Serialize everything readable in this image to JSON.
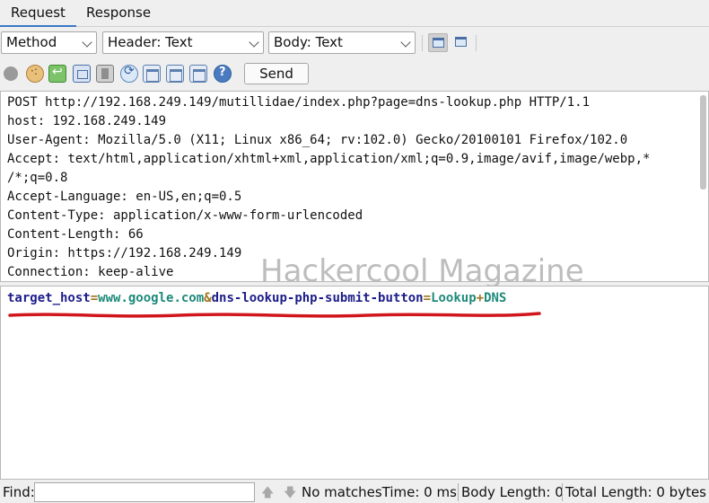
{
  "tabs": [
    {
      "label": "Request",
      "active": true
    },
    {
      "label": "Response",
      "active": false
    }
  ],
  "toolbar": {
    "method_select": "Method",
    "header_select": "Header: Text",
    "body_select": "Body: Text",
    "send_label": "Send",
    "icons": [
      "status-dot-icon",
      "cookie-icon",
      "follow-redirect-icon",
      "frame-icon",
      "box-icon",
      "refresh-icon",
      "window-icon",
      "list-window-icon",
      "table-window-icon",
      "help-icon"
    ]
  },
  "headers": [
    "POST http://192.168.249.149/mutillidae/index.php?page=dns-lookup.php HTTP/1.1",
    "host: 192.168.249.149",
    "User-Agent: Mozilla/5.0 (X11; Linux x86_64; rv:102.0) Gecko/20100101 Firefox/102.0",
    "Accept: text/html,application/xhtml+xml,application/xml;q=0.9,image/avif,image/webp,*",
    "/*;q=0.8",
    "Accept-Language: en-US,en;q=0.5",
    "Content-Type: application/x-www-form-urlencoded",
    "Content-Length: 66",
    "Origin: https://192.168.249.149",
    "Connection: keep-alive"
  ],
  "watermark": "Hackercool Magazine",
  "body": {
    "key1": "target_host",
    "eq1": "=",
    "val1": "www.google.com",
    "amp": "&",
    "key2": "dns-lookup-php-submit-button",
    "eq2": "=",
    "val2a": "Lookup",
    "plus": "+",
    "val2b": "DNS",
    "underline_color": "#d0161c"
  },
  "findbar": {
    "label": "Find:",
    "value": "",
    "status": "No matches",
    "time": "Time: 0 ms",
    "body_length": "Body Length: 0",
    "total_length": "Total Length: 0 bytes"
  },
  "colors": {
    "accent": "#3a79c4",
    "key": "#1c1c8a",
    "value": "#1e8a7a",
    "operator": "#a0731c"
  }
}
